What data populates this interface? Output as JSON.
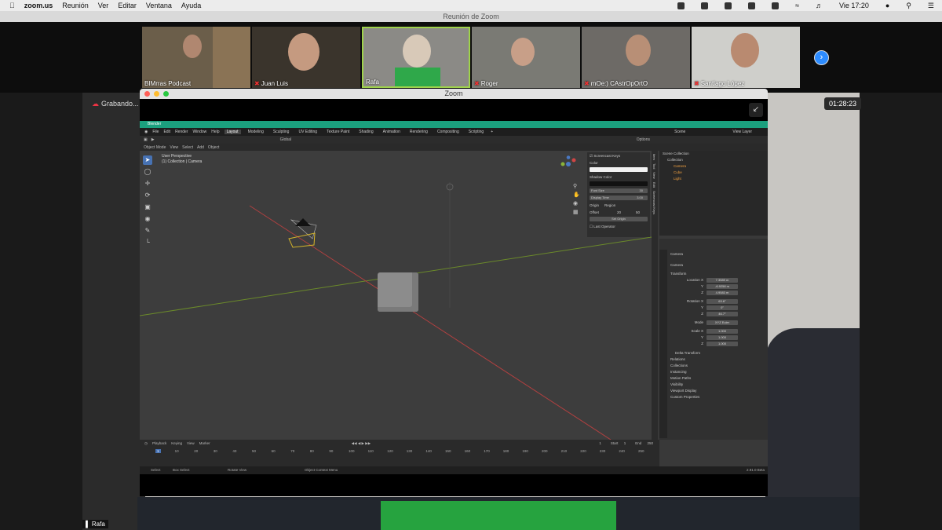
{
  "menubar": {
    "app": "zoom.us",
    "items": [
      "Reunión",
      "Ver",
      "Editar",
      "Ventana",
      "Ayuda"
    ],
    "clock": "Vie 17:20"
  },
  "meeting": {
    "title": "Reunión de Zoom",
    "participants": [
      {
        "name": "BIMrras Podcast"
      },
      {
        "name": "Juan Luis"
      },
      {
        "name": "Rafa"
      },
      {
        "name": "Roger"
      },
      {
        "name": "mOe:) CAstrOpOrtO"
      },
      {
        "name": "Santiago López"
      }
    ],
    "recording": "Grabando...",
    "timer": "01:28:23",
    "speaker": "Rafa"
  },
  "share": {
    "title": "Zoom"
  },
  "blender": {
    "title": "Blender",
    "menu": [
      "File",
      "Edit",
      "Render",
      "Window",
      "Help"
    ],
    "workspaces": [
      "Layout",
      "Modeling",
      "Sculpting",
      "UV Editing",
      "Texture Paint",
      "Shading",
      "Animation",
      "Rendering",
      "Compositing",
      "Scripting"
    ],
    "scene": "Scene",
    "view_layer": "View Layer",
    "mode": "Object Mode",
    "header_menu": [
      "View",
      "Select",
      "Add",
      "Object"
    ],
    "orientation": "Global",
    "options": "Options",
    "viewport_title": "User Perspective",
    "viewport_sub": "(1) Collection | Camera",
    "screencast": {
      "title": "Screencast Keys",
      "color": "Color",
      "shadow_color": "Shadow Color",
      "font_size_label": "Font Size",
      "font_size": "30",
      "display_time_label": "Display Time",
      "display_time": "3.00",
      "origin_label": "Origin",
      "origin": "Region",
      "offset_label": "Offset",
      "offset_x": "20",
      "offset_y": "50",
      "set_origin": "Set Origin",
      "last_operator": "Last Operator"
    },
    "side_tabs": [
      "Item",
      "Tool",
      "View",
      "Edit",
      "Screencast Keys"
    ],
    "outliner": [
      "Scene Collection",
      "Collection",
      "Camera",
      "Cube",
      "Light"
    ],
    "props": {
      "object": "Camera",
      "data": "Camera",
      "transform": "Transform",
      "location_label": "Location X",
      "location": [
        "7.3589 m",
        "-6.9258 m",
        "4.9583 m"
      ],
      "rotation_label": "Rotation X",
      "rotation": [
        "63.6°",
        "0°",
        "46.7°"
      ],
      "mode_label": "Mode",
      "mode": "XYZ Euler",
      "scale_label": "Scale X",
      "scale": [
        "1.000",
        "1.000",
        "1.000"
      ],
      "y": "Y",
      "z": "Z",
      "sections": [
        "Delta Transform",
        "Relations",
        "Collections",
        "Instancing",
        "Motion Paths",
        "Visibility",
        "Viewport Display",
        "Custom Properties"
      ]
    },
    "timeline": {
      "menu": [
        "Playback",
        "Keying",
        "View",
        "Marker"
      ],
      "frame": "1",
      "start_label": "Start",
      "start": "1",
      "end_label": "End",
      "end": "250",
      "ruler": [
        "1",
        "10",
        "20",
        "30",
        "40",
        "50",
        "60",
        "70",
        "80",
        "90",
        "100",
        "110",
        "120",
        "130",
        "140",
        "150",
        "160",
        "170",
        "180",
        "190",
        "200",
        "210",
        "220",
        "230",
        "240",
        "250"
      ]
    },
    "status": {
      "select": "Select",
      "box_select": "Box Select",
      "rotate_view": "Rotate View",
      "context_menu": "Object Context Menu",
      "version": "2.91.0 Beta"
    }
  }
}
